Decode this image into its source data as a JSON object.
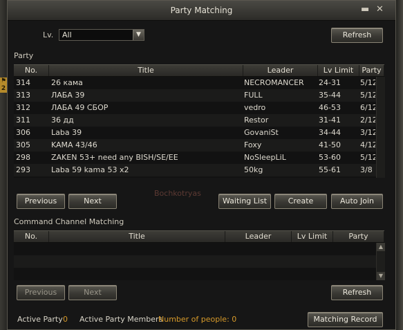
{
  "window": {
    "title": "Party Matching"
  },
  "filter": {
    "lv_label": "Lv.",
    "lv_value": "All",
    "refresh_label": "Refresh"
  },
  "party": {
    "section_label": "Party",
    "columns": [
      "No.",
      "Title",
      "Leader",
      "Lv Limit",
      "Party"
    ],
    "rows": [
      {
        "no": "314",
        "title": "26 кама",
        "leader": "NECROMANCER",
        "lv": "24-31",
        "party": "5/12"
      },
      {
        "no": "313",
        "title": "ЛАБА 39",
        "leader": "FULL",
        "lv": "35-44",
        "party": "5/12"
      },
      {
        "no": "312",
        "title": "ЛАБА 49 СБОР",
        "leader": "vedro",
        "lv": "46-53",
        "party": "6/12"
      },
      {
        "no": "311",
        "title": "36 дд",
        "leader": "Restor",
        "lv": "31-41",
        "party": "2/12"
      },
      {
        "no": "306",
        "title": "Laba 39",
        "leader": "GovaniSt",
        "lv": "34-44",
        "party": "3/12"
      },
      {
        "no": "305",
        "title": "KAMA 43/46",
        "leader": "Foxy",
        "lv": "41-50",
        "party": "4/12"
      },
      {
        "no": "298",
        "title": "ZAKEN 53+  need  any BISH/SE/EE",
        "leader": "NoSleepLiL",
        "lv": "53-60",
        "party": "5/12"
      },
      {
        "no": "293",
        "title": "Laba 59 kama 53 x2",
        "leader": "50kg",
        "lv": "55-61",
        "party": "3/8"
      }
    ],
    "ghost_text": "Bochkotryas",
    "buttons": {
      "previous": "Previous",
      "next": "Next",
      "waiting_list": "Waiting List",
      "create": "Create",
      "auto_join": "Auto Join"
    }
  },
  "channel": {
    "section_label": "Command Channel Matching",
    "columns": [
      "No.",
      "Title",
      "Leader",
      "Lv Limit",
      "Party"
    ],
    "buttons": {
      "previous": "Previous",
      "next": "Next",
      "refresh": "Refresh"
    }
  },
  "footer": {
    "active_party_label": "Active Party",
    "active_party_value": "0",
    "members_label": "Active Party Members",
    "members_value": "Number of people: 0",
    "matching_record": "Matching Record"
  },
  "side_tab": {
    "text": "2"
  },
  "icons": {
    "minimize": "minimize-icon",
    "close": "close-icon",
    "combo": "chevron-down-icon",
    "scroll_up": "arrow-up-icon",
    "scroll_down": "arrow-down-icon"
  },
  "colors": {
    "accent": "#d79a2a",
    "background": "#161616"
  }
}
